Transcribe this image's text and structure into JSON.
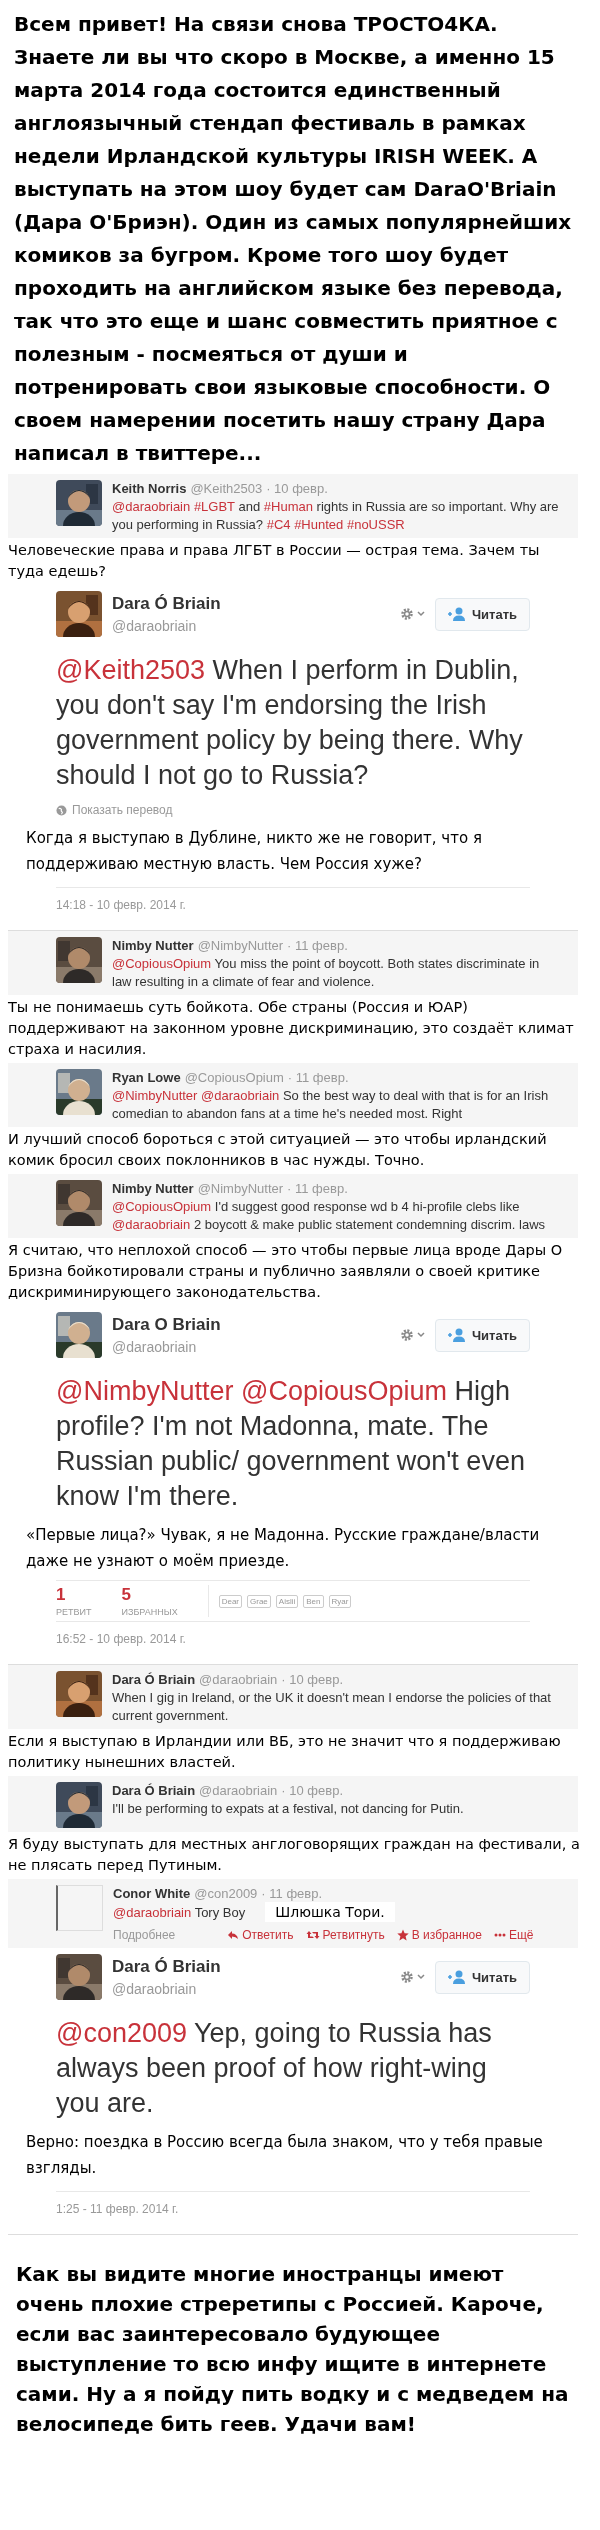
{
  "blocks": [
    {
      "kind": "caption",
      "text": "Всем привет! На связи снова ТРОСТО4КА. Знаете ли вы что скоро в Москве, а именно 15 марта 2014 года состоится единственный англоязычный стендап фестиваль в рамках недели Ирландской культуры IRISH WEEK. А выступать на этом шоу будет сам DaraO'Briain (Дара О'Бриэн). Один из самых популярнейших комиков за бугром. Кроме того шоу будет проходить на английском языке без перевода, так что это еще и шанс совместить приятное с полезным - посмеяться от души и потренировать свои языковые способности. О своем намерении посетить нашу страну Дара написал в твиттере..."
    },
    {
      "kind": "reply",
      "has_photo": true,
      "name": "Keith Norris",
      "handle": "@Keith2503",
      "date": "· 10 февр.",
      "segments": [
        {
          "kind": "mention",
          "text": "@daraobriain"
        },
        {
          "kind": "hashtag",
          "text": "#LGBT"
        },
        {
          "kind": "plain",
          "text": "and"
        },
        {
          "kind": "hashtag",
          "text": "#Human"
        },
        {
          "kind": "plain",
          "text": "rights in Russia are so important. Why are you performing in Russia?"
        },
        {
          "kind": "hashtag",
          "text": "#C4"
        },
        {
          "kind": "hashtag",
          "text": "#Hunted"
        },
        {
          "kind": "hashtag",
          "text": "#noUSSR"
        }
      ]
    },
    {
      "kind": "translation",
      "text": "Человеческие права и права ЛГБТ в России — острая тема. Зачем ты туда едешь?"
    },
    {
      "kind": "tweet",
      "name": "Dara Ó Briain",
      "handle": "@daraobriain",
      "follow": "Читать",
      "segments": [
        {
          "kind": "mention",
          "text": "@Keith2503"
        },
        {
          "kind": "plain",
          "text": "When I perform in Dublin, you don't say I'm endorsing the Irish government policy by being there. Why should I not go to Russia?"
        }
      ],
      "show_translation": "Показать перевод",
      "translation": "Когда я выступаю в Дублине, никто же не говорит, что я поддерживаю местную власть. Чем Россия хуже?",
      "timestamp": "14:18 - 10 февр. 2014 г."
    },
    {
      "kind": "reply",
      "has_photo": true,
      "name": "Nimby Nutter",
      "handle": "@NimbyNutter",
      "date": "· 11 февр.",
      "segments": [
        {
          "kind": "mention",
          "text": "@CopiousOpium"
        },
        {
          "kind": "plain",
          "text": "You miss the point of boycott. Both states discriminate in law resulting in a climate of fear and violence."
        }
      ]
    },
    {
      "kind": "translation",
      "text": "Ты не понимаешь суть бойкота. Обе страны (Россия и ЮАР) поддерживают на законном уровне дискриминацию, это создаёт климат страха и насилия."
    },
    {
      "kind": "reply",
      "has_photo": true,
      "name": "Ryan Lowe",
      "handle": "@CopiousOpium",
      "date": "· 11 февр.",
      "segments": [
        {
          "kind": "mention",
          "text": "@NimbyNutter"
        },
        {
          "kind": "mention",
          "text": "@daraobriain"
        },
        {
          "kind": "plain",
          "text": "So the best way to deal with that is for an Irish comedian to abandon fans at a time he's needed most. Right"
        }
      ]
    },
    {
      "kind": "translation",
      "text": "И лучший способ бороться с этой ситуацией — это чтобы ирландский комик бросил своих поклонников в час нужды. Точно."
    },
    {
      "kind": "reply",
      "has_photo": true,
      "name": "Nimby Nutter",
      "handle": "@NimbyNutter",
      "date": "· 11 февр.",
      "segments": [
        {
          "kind": "mention",
          "text": "@CopiousOpium"
        },
        {
          "kind": "plain",
          "text": "I'd suggest good response wd b 4 hi-profile clebs like"
        },
        {
          "kind": "mention",
          "text": "@daraobriain"
        },
        {
          "kind": "plain",
          "text": "2 boycott & make public statement condemning discrim. laws"
        }
      ]
    },
    {
      "kind": "translation",
      "text": "Я считаю, что неплохой способ — это чтобы первые лица вроде Дары О Бризна бойкотировали страны и публично заявляли о своей критике дискриминирующего законодательства."
    },
    {
      "kind": "tweet",
      "name": "Dara O Briain",
      "handle": "@daraobriain",
      "follow": "Читать",
      "segments": [
        {
          "kind": "mention",
          "text": "@NimbyNutter"
        },
        {
          "kind": "mention",
          "text": "@CopiousOpium"
        },
        {
          "kind": "plain",
          "text": "High profile? I'm not Madonna, mate. The Russian public/ government won't even know I'm there."
        }
      ],
      "translation": "«Первые лица?» Чувак, я не Мадонна. Русские граждане/власти даже не узнают о моём приезде.",
      "stats": [
        {
          "count": "1",
          "label": "РЕТВИТ"
        },
        {
          "count": "5",
          "label": "ИЗБРАННЫХ"
        }
      ],
      "favoriters": [
        "Dear",
        "Grae",
        "Aislii",
        "Ben",
        "Ryar"
      ],
      "timestamp": "16:52 - 10 февр. 2014 г."
    },
    {
      "kind": "reply",
      "has_photo": true,
      "name": "Dara Ó Briain",
      "handle": "@daraobriain",
      "date": "· 10 февр.",
      "segments": [
        {
          "kind": "plain",
          "text": "When I gig in Ireland, or the UK it doesn't mean I endorse the policies of that current government."
        }
      ]
    },
    {
      "kind": "translation",
      "text": "Если я выступаю в Ирландии или ВБ, это не значит что я поддерживаю политику нынешних властей."
    },
    {
      "kind": "reply",
      "has_photo": true,
      "name": "Dara Ó Briain",
      "handle": "@daraobriain",
      "date": "· 10 февр.",
      "segments": [
        {
          "kind": "plain",
          "text": "I'll be performing to expats at a festival, not dancing for Putin."
        }
      ]
    },
    {
      "kind": "translation",
      "text": "Я буду выступать для местных англоговорящих граждан на фестивали, а не плясать перед Путиным."
    },
    {
      "kind": "reply",
      "has_photo": false,
      "name": "Conor White",
      "handle": "@con2009",
      "date": "· 11 февр.",
      "segments": [
        {
          "kind": "mention",
          "text": "@daraobriain"
        },
        {
          "kind": "plain",
          "text": "Tory Boy"
        }
      ],
      "overlay": "Шлюшка Тори.",
      "details": "Подробнее",
      "actions": [
        {
          "kind": "reply",
          "label": "Ответить"
        },
        {
          "kind": "retweet",
          "label": "Ретвитнуть"
        },
        {
          "kind": "favorite",
          "label": "В избранное"
        },
        {
          "kind": "more",
          "label": "Ещё"
        }
      ]
    },
    {
      "kind": "tweet",
      "name": "Dara Ó Briain",
      "handle": "@daraobriain",
      "follow": "Читать",
      "segments": [
        {
          "kind": "mention",
          "text": "@con2009"
        },
        {
          "kind": "plain",
          "text": "Yep, going to Russia has always been proof of how right-wing you are."
        }
      ],
      "translation": "Верно: поездка в Россию всегда была знаком, что у тебя правые взгляды.",
      "timestamp": "1:25 - 11 февр. 2014 г."
    },
    {
      "kind": "caption",
      "text": "Как вы видите многие иностранцы имеют очень плохие стреретипы с Россией. Кароче, если вас заинтересовало будующее выступление то всю инфу ищите в интернете сами. Ну а я пойду пить водку и с медведем на велосипеде бить геев. Удачи вам!"
    }
  ]
}
